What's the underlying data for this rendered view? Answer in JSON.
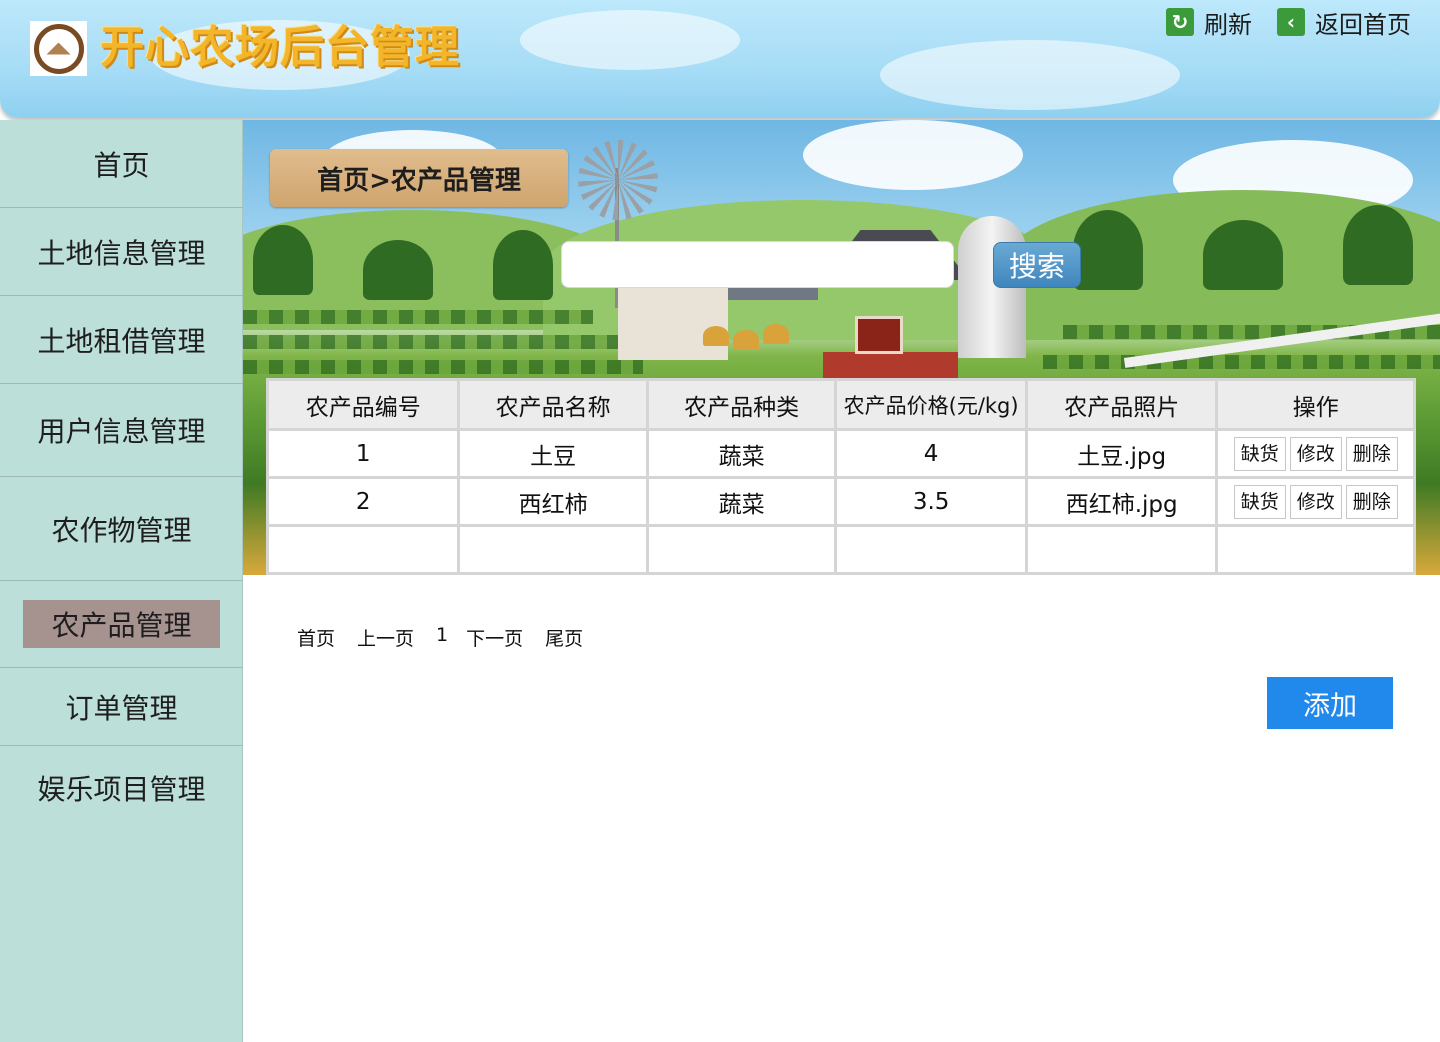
{
  "header": {
    "title": "开心农场后台管理",
    "refresh_label": "刷新",
    "home_label": "返回首页",
    "refresh_icon": "refresh-icon",
    "home_icon": "back-arrow-icon"
  },
  "sidebar": {
    "items": [
      {
        "label": "首页"
      },
      {
        "label": "土地信息管理"
      },
      {
        "label": "土地租借管理"
      },
      {
        "label": "用户信息管理"
      },
      {
        "label": "农作物管理"
      },
      {
        "label": "农产品管理",
        "active": true
      },
      {
        "label": "订单管理"
      },
      {
        "label": "娱乐项目管理"
      }
    ]
  },
  "main": {
    "breadcrumb": "首页>农产品管理",
    "search": {
      "value": "",
      "placeholder": "",
      "button_label": "搜索"
    },
    "table": {
      "headers": [
        "农产品编号",
        "农产品名称",
        "农产品种类",
        "农产品价格(元/kg)",
        "农产品照片",
        "操作"
      ],
      "rows": [
        {
          "id": "1",
          "name": "土豆",
          "type": "蔬菜",
          "price": "4",
          "photo": "土豆.jpg"
        },
        {
          "id": "2",
          "name": "西红柿",
          "type": "蔬菜",
          "price": "3.5",
          "photo": "西红柿.jpg"
        }
      ],
      "actions": [
        "缺货",
        "修改",
        "删除"
      ]
    },
    "pagination": {
      "first": "首页",
      "prev": "上一页",
      "page": "1",
      "next": "下一页",
      "last": "尾页"
    },
    "add_label": "添加"
  },
  "colors": {
    "sidebar_bg": "#bddfd9",
    "active_nav": "#a69390",
    "title_yellow": "#f3b52a",
    "add_button": "#2189ec",
    "search_button": "#4a8fc4"
  }
}
